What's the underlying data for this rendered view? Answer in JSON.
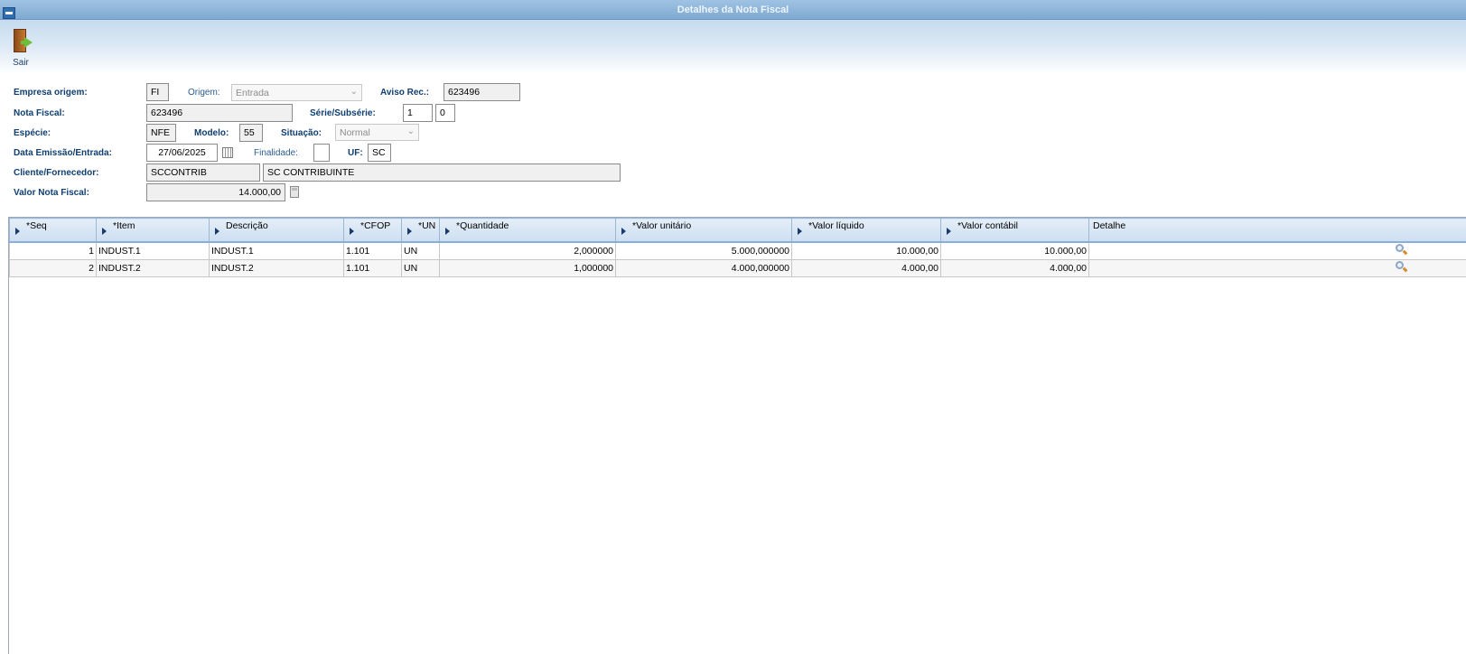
{
  "window": {
    "title": "Detalhes da Nota Fiscal"
  },
  "toolbar": {
    "sair_label": "Sair"
  },
  "form": {
    "empresa_origem": {
      "label": "Empresa origem:",
      "value": "FI"
    },
    "origem": {
      "label": "Origem:",
      "value": "Entrada"
    },
    "aviso_rec": {
      "label": "Aviso Rec.:",
      "value": "623496"
    },
    "nota_fiscal": {
      "label": "Nota Fiscal:",
      "value": "623496"
    },
    "serie_subserie": {
      "label": "Série/Subsérie:",
      "serie": "1",
      "subserie": "0"
    },
    "especie": {
      "label": "Espécie:",
      "value": "NFE"
    },
    "modelo": {
      "label": "Modelo:",
      "value": "55"
    },
    "situacao": {
      "label": "Situação:",
      "value": "Normal"
    },
    "data_emissao": {
      "label": "Data Emissão/Entrada:",
      "value": "27/06/2025"
    },
    "finalidade": {
      "label": "Finalidade:",
      "value": ""
    },
    "uf": {
      "label": "UF:",
      "value": "SC"
    },
    "cliente_fornecedor": {
      "label": "Cliente/Fornecedor:",
      "code": "SCCONTRIB",
      "name": "SC CONTRIBUINTE"
    },
    "valor_nota_fiscal": {
      "label": "Valor Nota Fiscal:",
      "value": "14.000,00"
    }
  },
  "grid": {
    "headers": {
      "seq": "*Seq",
      "item": "*Item",
      "descricao": "Descrição",
      "cfop": "*CFOP",
      "un": "*UN",
      "quantidade": "*Quantidade",
      "valor_unitario": "*Valor unitário",
      "valor_liquido": "*Valor líquido",
      "valor_contabil": "*Valor contábil",
      "detalhe": "Detalhe"
    },
    "rows": [
      {
        "seq": "1",
        "item": "INDUST.1",
        "descricao": "INDUST.1",
        "cfop": "1.101",
        "un": "UN",
        "quantidade": "2,000000",
        "valor_unitario": "5.000,000000",
        "valor_liquido": "10.000,00",
        "valor_contabil": "10.000,00"
      },
      {
        "seq": "2",
        "item": "INDUST.2",
        "descricao": "INDUST.2",
        "cfop": "1.101",
        "un": "UN",
        "quantidade": "1,000000",
        "valor_unitario": "4.000,000000",
        "valor_liquido": "4.000,00",
        "valor_contabil": "4.000,00"
      }
    ]
  },
  "icons": {
    "window": "window-icon",
    "exit": "exit-door-icon",
    "calendar": "calendar-icon",
    "calculator": "calculator-icon",
    "detail": "magnifier-icon",
    "sort": "sort-arrow-icon"
  }
}
